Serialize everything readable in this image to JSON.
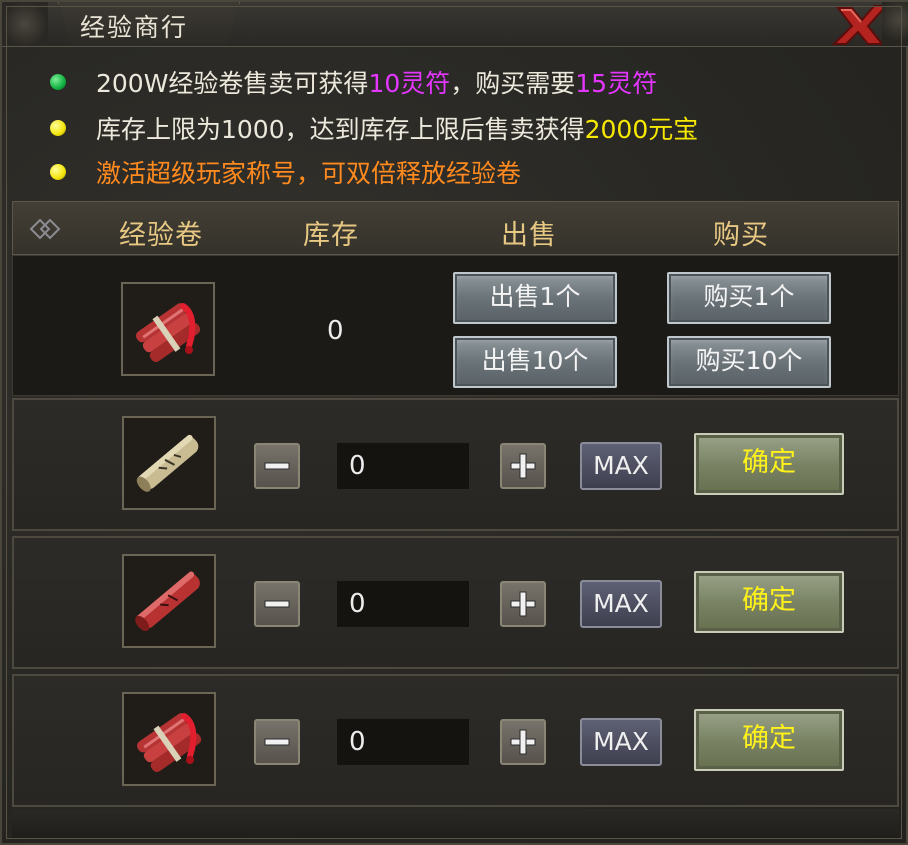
{
  "window": {
    "title": "经验商行"
  },
  "info_lines": [
    {
      "dot": "green",
      "parts": [
        "200W经验卷售卖可获得",
        "10灵符",
        "，购买需要",
        "15灵符"
      ]
    },
    {
      "dot": "yellow",
      "parts": [
        "库存上限为1000，达到库存上限后售卖获得",
        "2000元宝"
      ]
    },
    {
      "dot": "yellow",
      "parts": [
        "激活超级玩家称号，可双倍释放经验卷"
      ]
    }
  ],
  "header": {
    "col_item": "经验卷",
    "col_stock": "库存",
    "col_sell": "出售",
    "col_buy": "购买"
  },
  "main_row": {
    "stock": "0",
    "sell_1": "出售1个",
    "sell_10": "出售10个",
    "buy_1": "购买1个",
    "buy_10": "购买10个"
  },
  "rows": [
    {
      "qty": "0",
      "max_label": "MAX",
      "confirm_label": "确定",
      "icon": "old-scroll-icon"
    },
    {
      "qty": "0",
      "max_label": "MAX",
      "confirm_label": "确定",
      "icon": "red-scroll-icon"
    },
    {
      "qty": "0",
      "max_label": "MAX",
      "confirm_label": "确定",
      "icon": "red-scroll-bundle-icon"
    }
  ],
  "colors": {
    "highlight_magenta": "#e436ff",
    "highlight_yellow": "#f6e800",
    "orange_text": "#ff8a1e",
    "header_gold": "#e7c882",
    "confirm_text": "#fff21a"
  }
}
